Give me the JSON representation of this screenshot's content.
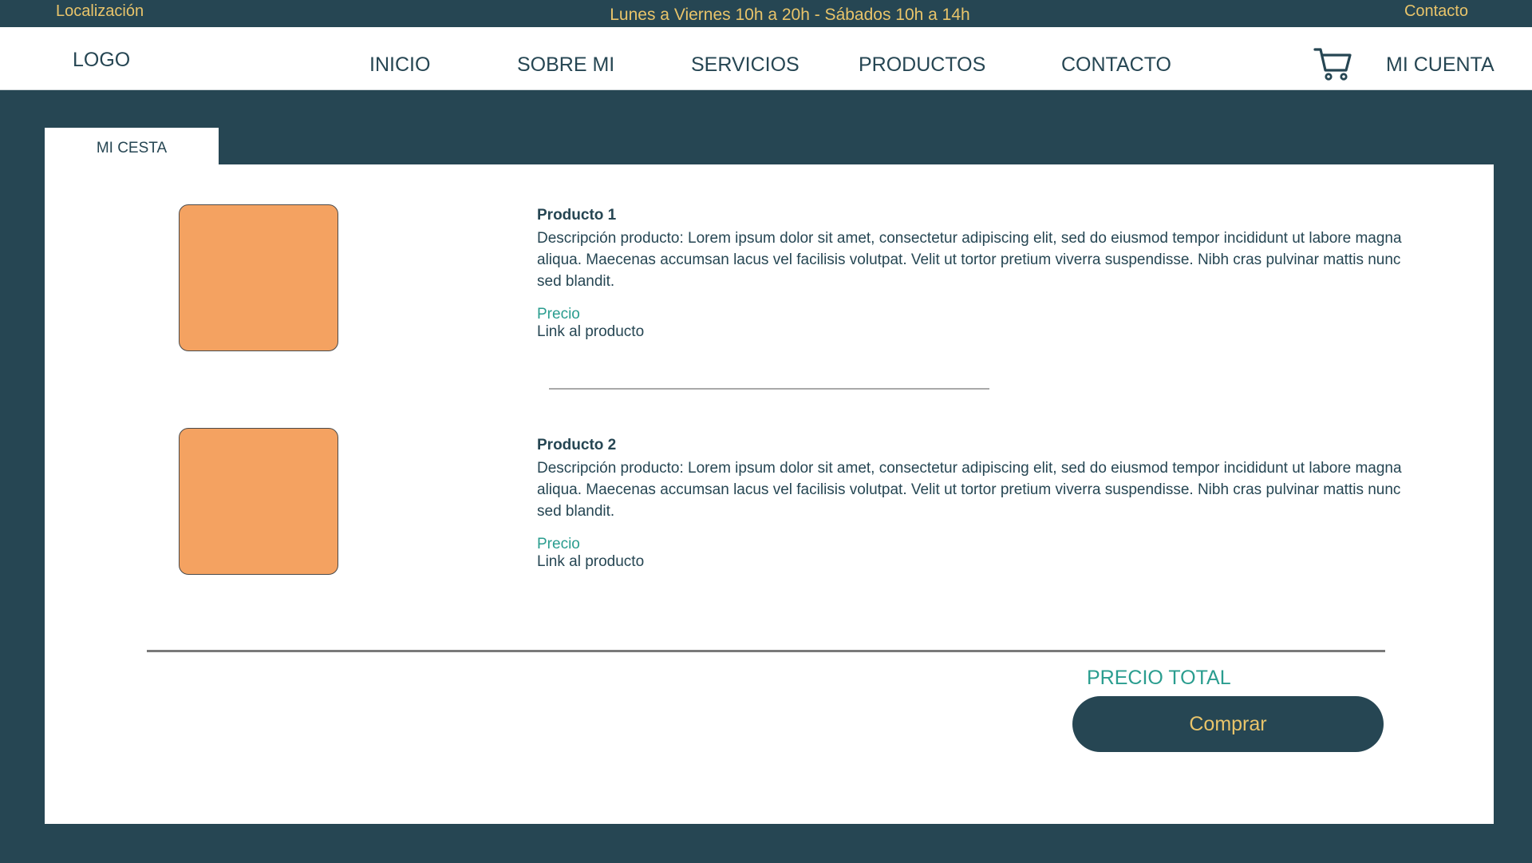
{
  "topbar": {
    "location": "Localización",
    "hours": "Lunes a Viernes 10h a 20h - Sábados 10h a 14h",
    "contact": "Contacto"
  },
  "header": {
    "logo": "LOGO",
    "nav": [
      "INICIO",
      "SOBRE MI",
      "SERVICIOS",
      "PRODUCTOS",
      "CONTACTO"
    ],
    "cart_icon": "shopping-cart-icon",
    "account": "MI CUENTA"
  },
  "tab": {
    "label": "MI CESTA"
  },
  "products": [
    {
      "title": "Producto 1",
      "description": "Descripción producto: Lorem ipsum dolor sit amet, consectetur adipiscing elit, sed do eiusmod tempor incididunt ut labore magna aliqua. Maecenas accumsan lacus vel facilisis volutpat. Velit ut tortor pretium viverra suspendisse. Nibh cras pulvinar mattis nunc sed blandit.",
      "price_label": "Precio",
      "link_label": "Link al producto"
    },
    {
      "title": "Producto 2",
      "description": "Descripción producto: Lorem ipsum dolor sit amet, consectetur adipiscing elit, sed do eiusmod tempor incididunt ut labore magna aliqua. Maecenas accumsan lacus vel facilisis volutpat. Velit ut tortor pretium viverra suspendisse. Nibh cras pulvinar mattis nunc sed blandit.",
      "price_label": "Precio",
      "link_label": "Link al producto"
    }
  ],
  "summary": {
    "total_label": "PRECIO TOTAL",
    "buy_label": "Comprar"
  },
  "colors": {
    "primary": "#264653",
    "accent": "#e9c46a",
    "teal": "#2a9d8f",
    "product_placeholder": "#f4a261"
  }
}
